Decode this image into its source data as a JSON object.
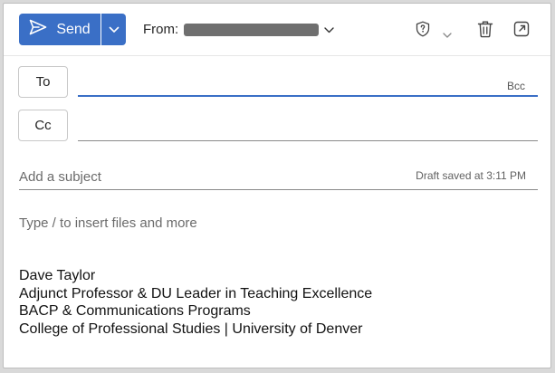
{
  "toolbar": {
    "send_label": "Send",
    "from_label": "From:"
  },
  "recipients": {
    "to_label": "To",
    "cc_label": "Cc",
    "bcc_label": "Bcc"
  },
  "subject": {
    "placeholder": "Add a subject",
    "draft_status": "Draft saved at 3:11 PM"
  },
  "body": {
    "placeholder": "Type / to insert files and more",
    "signature": [
      "Dave Taylor",
      "Adjunct Professor & DU Leader in Teaching Excellence",
      "BACP & Communications Programs",
      "College of Professional Studies | University of Denver"
    ]
  },
  "colors": {
    "accent": "#3a6fc6",
    "border": "#c8c8c8"
  },
  "icons": [
    "send-icon",
    "chevron-down-icon",
    "shield-question-icon",
    "trash-icon",
    "pop-out-icon"
  ]
}
